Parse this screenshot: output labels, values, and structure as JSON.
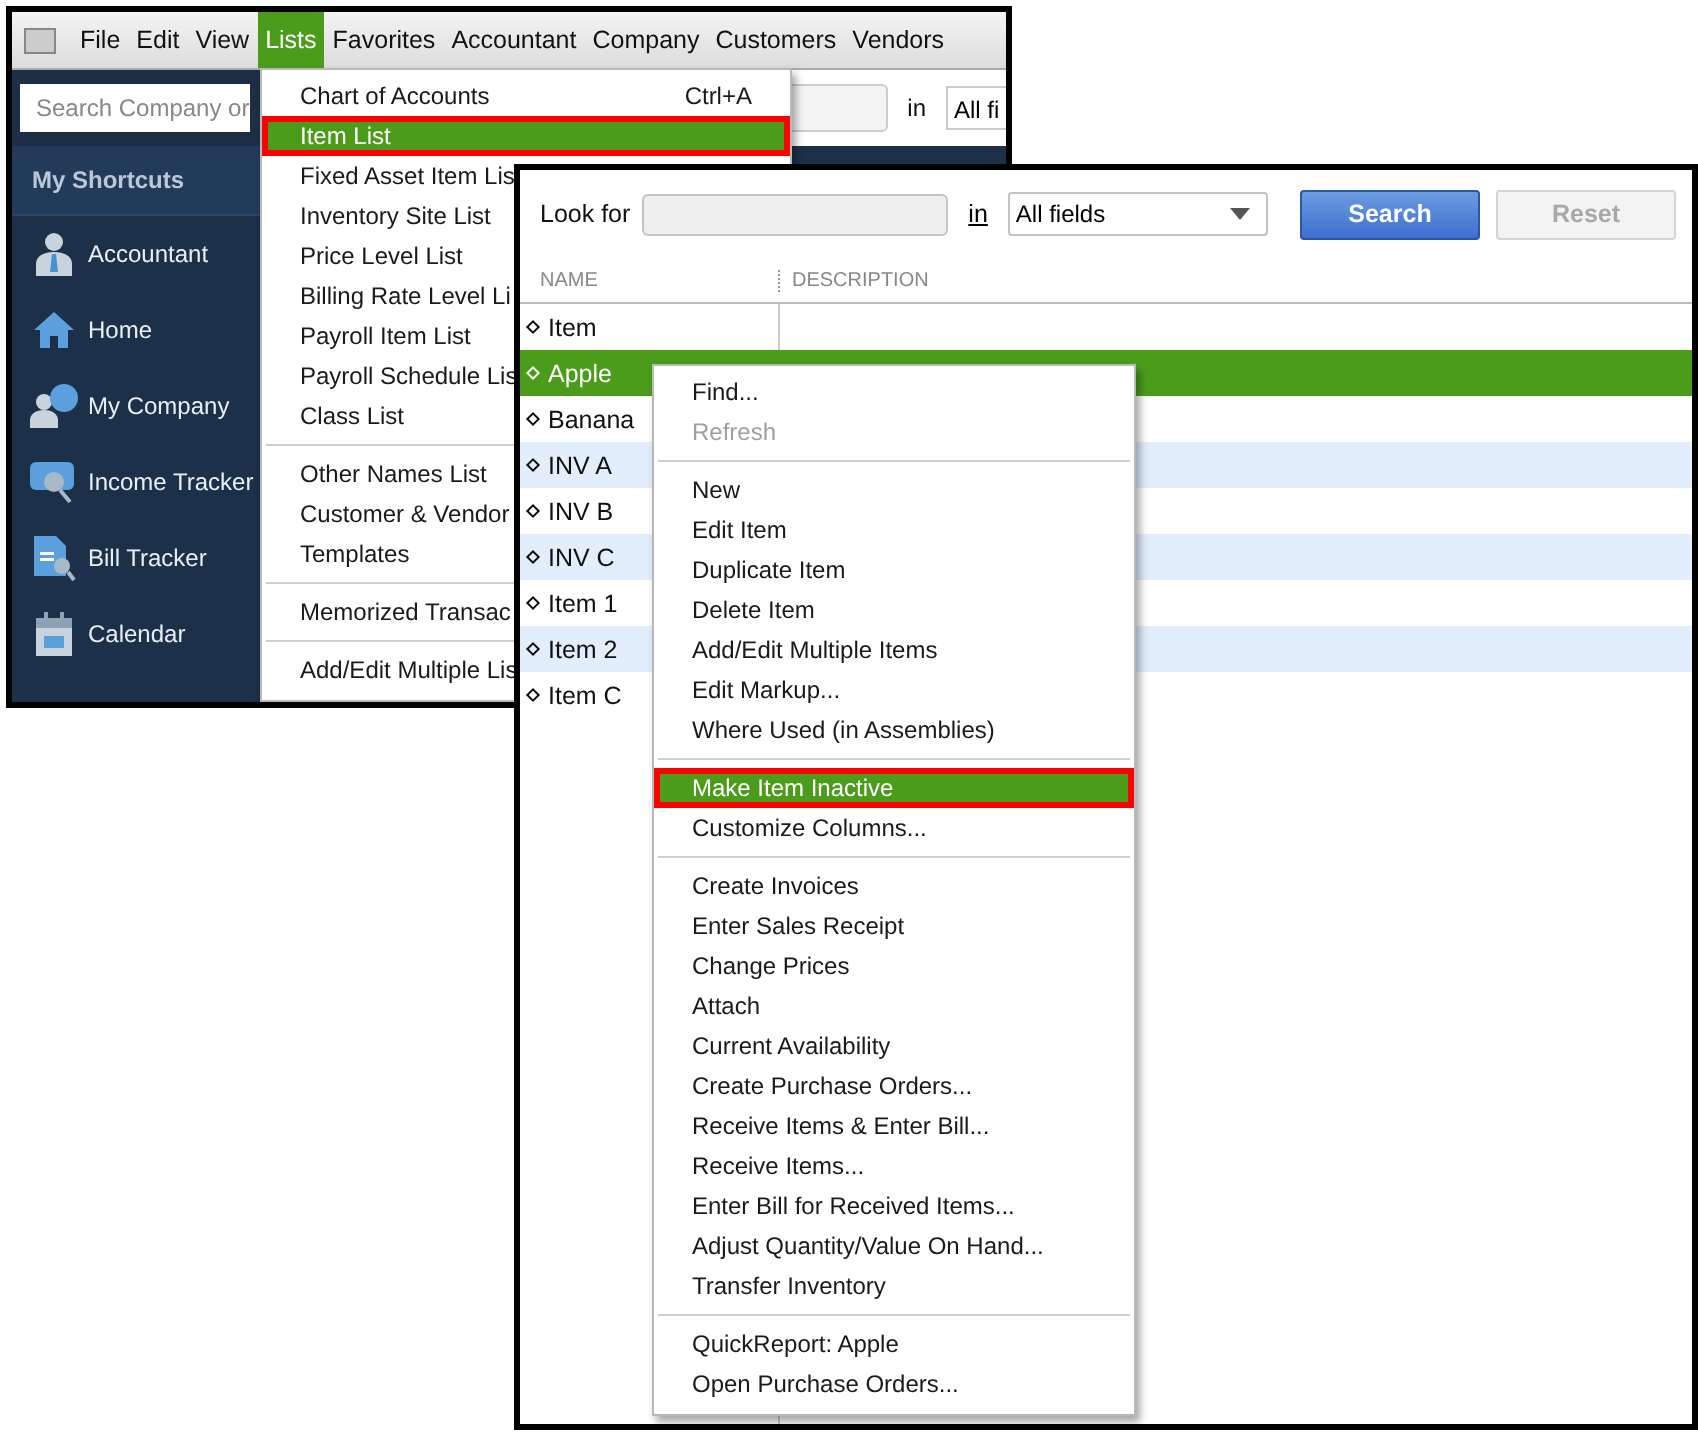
{
  "app_window": {
    "menu_bar": [
      {
        "label": "File",
        "selected": false
      },
      {
        "label": "Edit",
        "selected": false
      },
      {
        "label": "View",
        "selected": false
      },
      {
        "label": "Lists",
        "selected": true
      },
      {
        "label": "Favorites",
        "selected": false
      },
      {
        "label": "Accountant",
        "selected": false
      },
      {
        "label": "Company",
        "selected": false
      },
      {
        "label": "Customers",
        "selected": false
      },
      {
        "label": "Vendors",
        "selected": false
      }
    ],
    "search": {
      "placeholder": "Search Company or"
    },
    "find_bar": {
      "in_label": "in",
      "field_value": "All fi"
    },
    "shortcuts": {
      "title": "My Shortcuts",
      "items": [
        {
          "label": "Accountant",
          "kind": "person"
        },
        {
          "label": "Home",
          "kind": "house"
        },
        {
          "label": "My Company",
          "kind": "company"
        },
        {
          "label": "Income Tracker",
          "kind": "tracker"
        },
        {
          "label": "Bill Tracker",
          "kind": "bill"
        },
        {
          "label": "Calendar",
          "kind": "calendar"
        }
      ]
    }
  },
  "lists_menu": {
    "groups": [
      {
        "items": [
          {
            "label": "Chart of Accounts",
            "shortcut": "Ctrl+A",
            "selected": false,
            "outlined": false
          },
          {
            "label": "Item List",
            "selected": true,
            "outlined": true
          },
          {
            "label": "Fixed Asset Item Lis",
            "selected": false,
            "outlined": false
          },
          {
            "label": "Inventory Site List",
            "selected": false,
            "outlined": false
          },
          {
            "label": "Price Level List",
            "selected": false,
            "outlined": false
          },
          {
            "label": "Billing Rate Level Li",
            "selected": false,
            "outlined": false
          },
          {
            "label": "Payroll Item List",
            "selected": false,
            "outlined": false
          },
          {
            "label": "Payroll Schedule Lis",
            "selected": false,
            "outlined": false
          },
          {
            "label": "Class List",
            "selected": false,
            "outlined": false
          }
        ]
      },
      {
        "items": [
          {
            "label": "Other Names List",
            "selected": false,
            "outlined": false
          },
          {
            "label": "Customer & Vendor",
            "selected": false,
            "outlined": false
          },
          {
            "label": "Templates",
            "selected": false,
            "outlined": false
          }
        ]
      },
      {
        "items": [
          {
            "label": "Memorized Transac",
            "selected": false,
            "outlined": false
          }
        ]
      },
      {
        "items": [
          {
            "label": "Add/Edit Multiple Lis",
            "selected": false,
            "outlined": false
          }
        ]
      }
    ]
  },
  "item_list_window": {
    "look_for_label": "Look for",
    "in_label": "in",
    "field_select": "All fields",
    "buttons": [
      {
        "label": "Search",
        "kind": "primary",
        "disabled": false
      },
      {
        "label": "Reset",
        "kind": "secondary",
        "disabled": true
      }
    ],
    "columns": [
      "NAME",
      "DESCRIPTION"
    ],
    "rows": [
      {
        "name": "Item",
        "selected": false
      },
      {
        "name": "Apple",
        "selected": true
      },
      {
        "name": "Banana",
        "selected": false
      },
      {
        "name": "INV A",
        "selected": false
      },
      {
        "name": "INV B",
        "selected": false
      },
      {
        "name": "INV C",
        "selected": false
      },
      {
        "name": "Item 1",
        "selected": false
      },
      {
        "name": "Item 2",
        "selected": false
      },
      {
        "name": "Item C",
        "selected": false
      }
    ]
  },
  "context_menu": {
    "groups": [
      {
        "items": [
          {
            "label": "Find...",
            "disabled": false,
            "selected": false,
            "outlined": false
          },
          {
            "label": "Refresh",
            "disabled": true,
            "selected": false,
            "outlined": false
          }
        ]
      },
      {
        "items": [
          {
            "label": "New",
            "disabled": false,
            "selected": false,
            "outlined": false
          },
          {
            "label": "Edit Item",
            "disabled": false,
            "selected": false,
            "outlined": false
          },
          {
            "label": "Duplicate Item",
            "disabled": false,
            "selected": false,
            "outlined": false
          },
          {
            "label": "Delete Item",
            "disabled": false,
            "selected": false,
            "outlined": false
          },
          {
            "label": "Add/Edit Multiple Items",
            "disabled": false,
            "selected": false,
            "outlined": false
          },
          {
            "label": "Edit Markup...",
            "disabled": false,
            "selected": false,
            "outlined": false
          },
          {
            "label": "Where Used (in Assemblies)",
            "disabled": false,
            "selected": false,
            "outlined": false
          }
        ]
      },
      {
        "items": [
          {
            "label": "Make Item Inactive",
            "disabled": false,
            "selected": true,
            "outlined": true
          },
          {
            "label": "Customize Columns...",
            "disabled": false,
            "selected": false,
            "outlined": false
          }
        ]
      },
      {
        "items": [
          {
            "label": "Create Invoices",
            "disabled": false,
            "selected": false,
            "outlined": false
          },
          {
            "label": "Enter Sales Receipt",
            "disabled": false,
            "selected": false,
            "outlined": false
          },
          {
            "label": "Change Prices",
            "disabled": false,
            "selected": false,
            "outlined": false
          },
          {
            "label": "Attach",
            "disabled": false,
            "selected": false,
            "outlined": false
          },
          {
            "label": "Current Availability",
            "disabled": false,
            "selected": false,
            "outlined": false
          },
          {
            "label": "Create Purchase Orders...",
            "disabled": false,
            "selected": false,
            "outlined": false
          },
          {
            "label": "Receive Items & Enter Bill...",
            "disabled": false,
            "selected": false,
            "outlined": false
          },
          {
            "label": "Receive Items...",
            "disabled": false,
            "selected": false,
            "outlined": false
          },
          {
            "label": "Enter Bill for Received Items...",
            "disabled": false,
            "selected": false,
            "outlined": false
          },
          {
            "label": "Adjust Quantity/Value On Hand...",
            "disabled": false,
            "selected": false,
            "outlined": false
          },
          {
            "label": "Transfer Inventory",
            "disabled": false,
            "selected": false,
            "outlined": false
          }
        ]
      },
      {
        "items": [
          {
            "label": "QuickReport: Apple",
            "disabled": false,
            "selected": false,
            "outlined": false
          },
          {
            "label": "Open Purchase Orders...",
            "disabled": false,
            "selected": false,
            "outlined": false
          }
        ]
      }
    ]
  }
}
